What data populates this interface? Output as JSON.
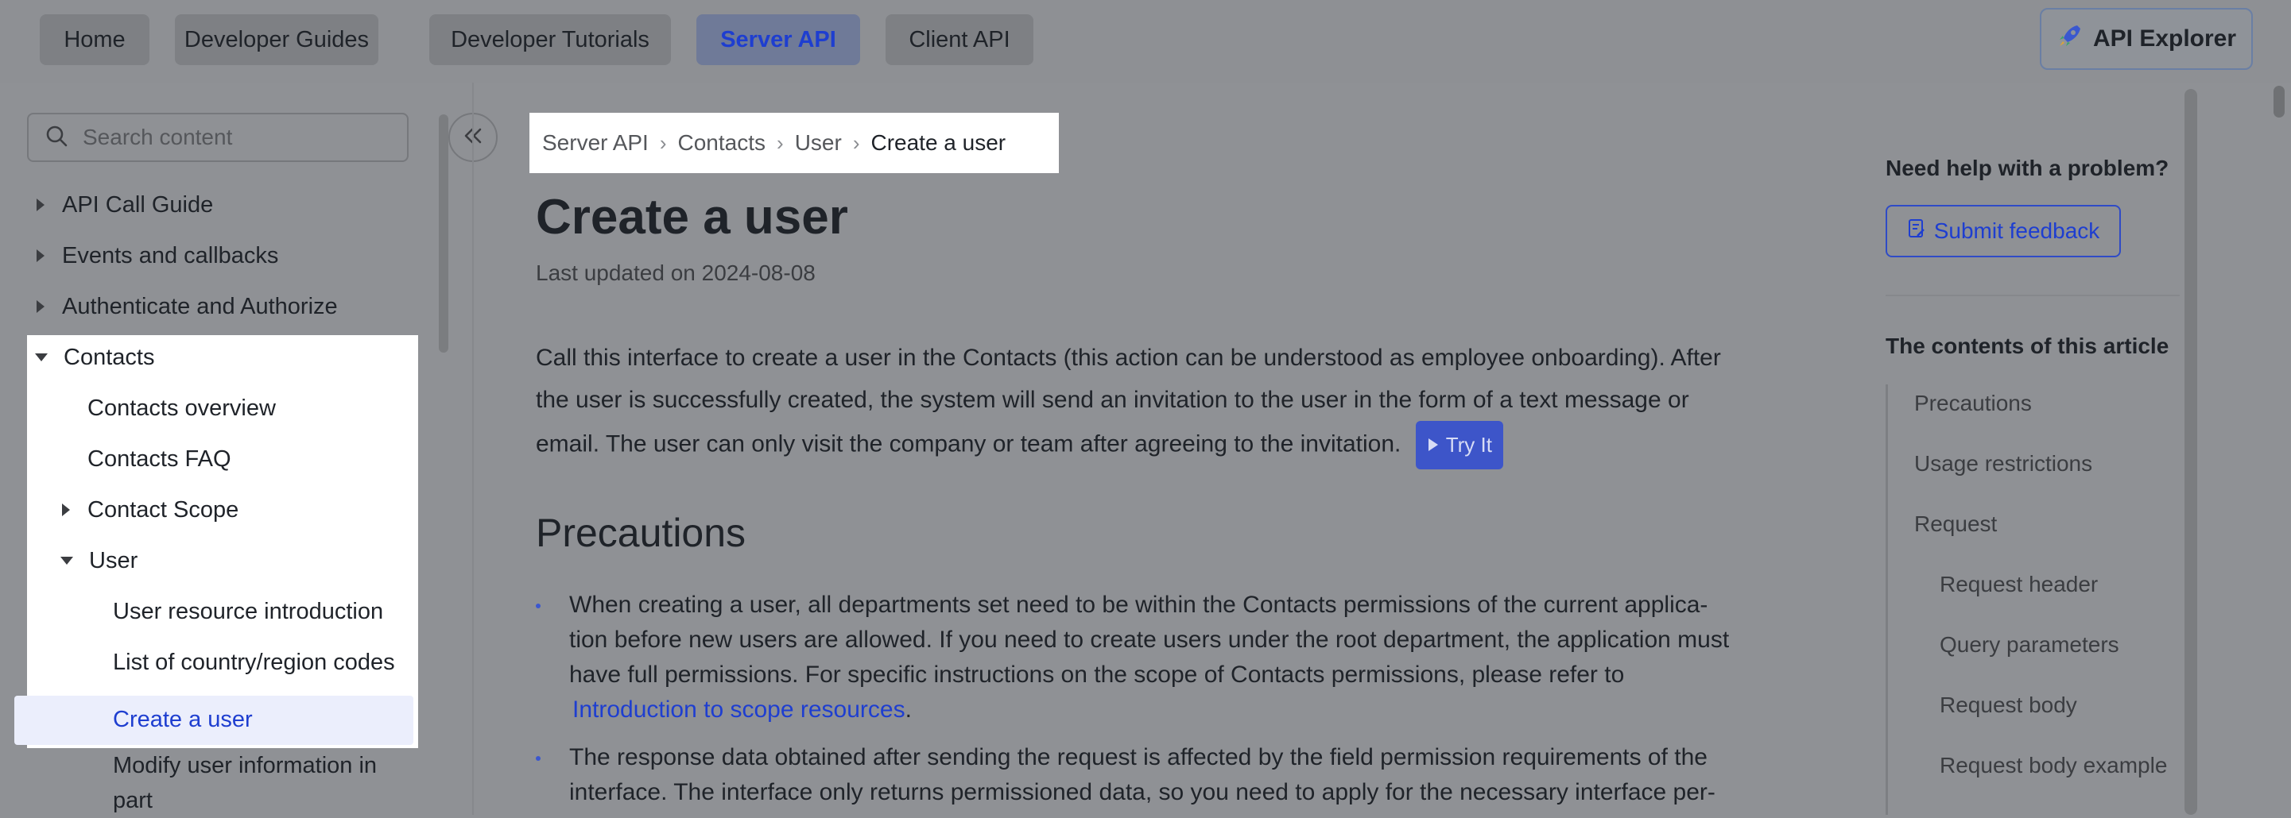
{
  "nav": {
    "tabs": [
      {
        "label": "Home"
      },
      {
        "label": "Developer Guides"
      },
      {
        "label": "Developer Tutorials"
      },
      {
        "label": "Server API"
      },
      {
        "label": "Client API"
      }
    ],
    "active_tab": "Server API",
    "explorer_label": "API Explorer"
  },
  "sidebar": {
    "search_placeholder": "Search content",
    "items": [
      {
        "label": "API Call Guide",
        "state": "collapsed"
      },
      {
        "label": "Events and callbacks",
        "state": "collapsed"
      },
      {
        "label": "Authenticate and Authorize",
        "state": "collapsed"
      },
      {
        "label": "Contacts",
        "state": "expanded"
      },
      {
        "label": "Contacts overview"
      },
      {
        "label": "Contacts FAQ"
      },
      {
        "label": "Contact Scope",
        "state": "collapsed"
      },
      {
        "label": "User",
        "state": "expanded"
      },
      {
        "label": "User resource introduction"
      },
      {
        "label": "List of country/region codes"
      },
      {
        "label": "Create a user",
        "selected": true
      },
      {
        "label": "Modify user information in part"
      }
    ]
  },
  "breadcrumb": [
    "Server API",
    "Contacts",
    "User",
    "Create a user"
  ],
  "article": {
    "title": "Create a user",
    "updated": "Last updated on 2024-08-08",
    "intro_l1": "Call this interface to create a user in the Contacts (this action can be understood as employee onboarding). After",
    "intro_l2": "the user is successfully created, the system will send an invitation to the user in the form of a text message or",
    "intro_l3": "email. The user can only visit the company or team after agreeing to the invitation.",
    "try_it": "Try It",
    "section_title": "Precautions",
    "b1_l1": "When creating a user, all departments set need to be within the Contacts permissions of the current applica-",
    "b1_l2": "tion before new users are allowed. If you need to create users under the root department, the application must",
    "b1_l3": "have full permissions. For specific instructions on the scope of Contacts permissions, please refer to",
    "b1_link": "Introduction to scope resources",
    "b1_end": ".",
    "b2_l1": "The response data obtained after sending the request is affected by the field permission requirements of the",
    "b2_l2": "interface. The interface only returns permissioned data, so you need to apply for the necessary interface per-"
  },
  "right_panel": {
    "help_title": "Need help with a problem?",
    "feedback_label": "Submit feedback",
    "toc_title": "The contents of this article",
    "toc": [
      {
        "label": "Precautions",
        "level": 1
      },
      {
        "label": "Usage restrictions",
        "level": 1
      },
      {
        "label": "Request",
        "level": 1
      },
      {
        "label": "Request header",
        "level": 2
      },
      {
        "label": "Query parameters",
        "level": 2
      },
      {
        "label": "Request body",
        "level": 2
      },
      {
        "label": "Request body example",
        "level": 2
      }
    ]
  },
  "colors": {
    "accent": "#1e3ed0",
    "overlay_bg": "#8f9195",
    "highlight": "#ffffff"
  }
}
